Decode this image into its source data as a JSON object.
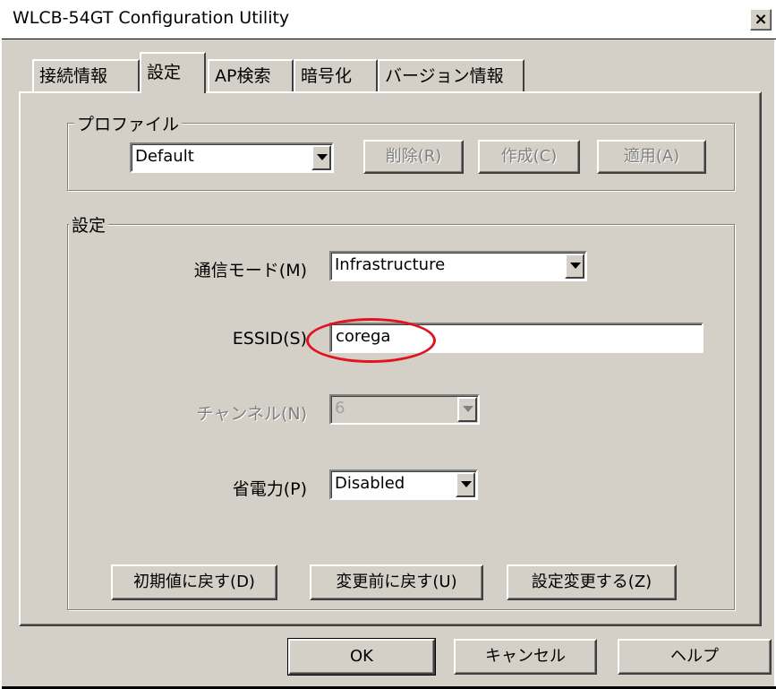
{
  "window": {
    "title": "WLCB-54GT Configuration Utility",
    "close_label": "×"
  },
  "tabs": [
    {
      "label": "接続情報"
    },
    {
      "label": "設定"
    },
    {
      "label": "AP検索"
    },
    {
      "label": "暗号化"
    },
    {
      "label": "バージョン情報"
    }
  ],
  "profile": {
    "legend": "プロファイル",
    "selected": "Default",
    "delete_label": "削除(R)",
    "create_label": "作成(C)",
    "apply_label": "適用(A)"
  },
  "settings": {
    "legend": "設定",
    "mode_label": "通信モード(M)",
    "mode_value": "Infrastructure",
    "essid_label": "ESSID(S)",
    "essid_value": "corega",
    "channel_label": "チャンネル(N)",
    "channel_value": "6",
    "power_label": "省電力(P)",
    "power_value": "Disabled",
    "reset_default_label": "初期値に戻す(D)",
    "revert_label": "変更前に戻す(U)",
    "apply_settings_label": "設定変更する(Z)"
  },
  "footer": {
    "ok_label": "OK",
    "cancel_label": "キャンセル",
    "help_label": "ヘルプ"
  },
  "colors": {
    "annotation": "#e0141e",
    "face": "#d4d0c8"
  }
}
